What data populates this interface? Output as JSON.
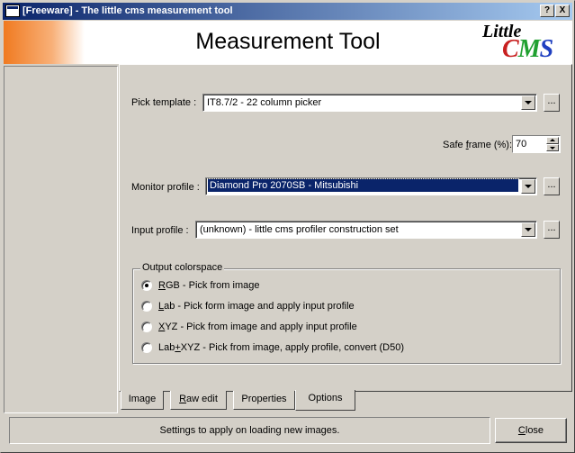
{
  "window": {
    "title": "[Freeware] - The little cms measurement tool",
    "help_button": "?",
    "close_button": "X"
  },
  "banner": {
    "heading": "Measurement Tool",
    "logo_top": "Little",
    "logo_letters": [
      "C",
      "M",
      "S"
    ],
    "colors": {
      "accent_orange": "#f07a20",
      "title_bar": "#0a246a",
      "logo_c": "#c82020",
      "logo_m": "#20a030",
      "logo_s": "#2040c0"
    }
  },
  "form": {
    "pick_template": {
      "label": "Pick template :",
      "value": "IT8.7/2 - 22 column picker",
      "browse": "..."
    },
    "safe_frame": {
      "label_pre": "Safe ",
      "label_ul": "f",
      "label_post": "rame (%):",
      "value": "70"
    },
    "monitor_profile": {
      "label": "Monitor profile :",
      "value": "Diamond Pro 2070SB - Mitsubishi",
      "browse": "..."
    },
    "input_profile": {
      "label": "Input profile :",
      "value": "(unknown) - little cms profiler construction set",
      "browse": "..."
    }
  },
  "output_colorspace": {
    "legend": "Output colorspace",
    "options": [
      {
        "ul": "R",
        "rest": "GB - Pick from image",
        "selected": true
      },
      {
        "ul": "L",
        "rest": "ab - Pick form image and apply input profile",
        "selected": false
      },
      {
        "ul": "X",
        "rest": "YZ - Pick from image and apply input profile",
        "selected": false
      },
      {
        "pre": "Lab",
        "ul": "+",
        "rest": "XYZ - Pick from image, apply profile, convert (D50)",
        "selected": false
      }
    ]
  },
  "tabs": [
    {
      "label": "Image",
      "active": false
    },
    {
      "pre": "",
      "ul": "R",
      "rest": "aw edit",
      "active": false
    },
    {
      "label": "Properties",
      "active": false
    },
    {
      "label": "Options",
      "active": true
    }
  ],
  "status": {
    "text": "Settings to apply on loading new images.",
    "close_pre": "",
    "close_ul": "C",
    "close_rest": "lose"
  }
}
